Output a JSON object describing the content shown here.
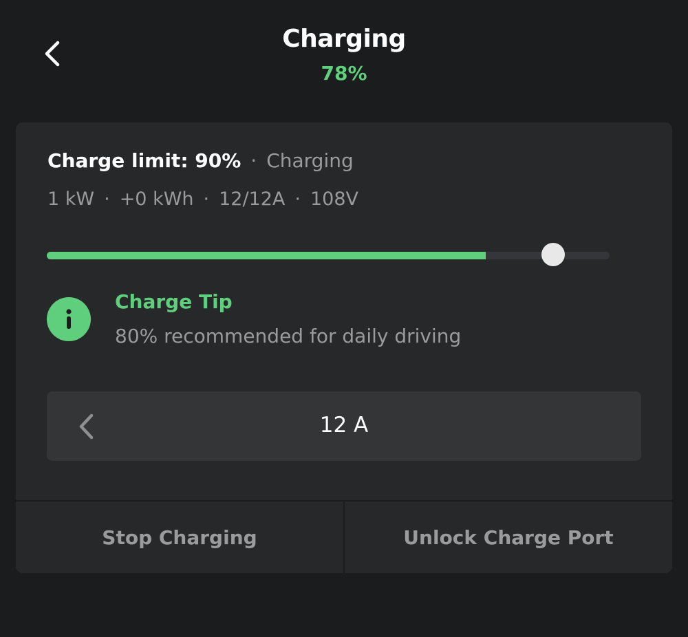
{
  "header": {
    "title": "Charging",
    "battery_percent": "78%"
  },
  "status": {
    "charge_limit": "Charge limit: 90%",
    "separator": "·",
    "state": "Charging"
  },
  "stats": {
    "power": "1 kW",
    "energy_added": "+0 kWh",
    "current": "12/12A",
    "voltage": "108V",
    "separator": "·"
  },
  "charge_level_slider": {
    "current_level": 0.78,
    "limit_level": 0.9
  },
  "tip": {
    "title": "Charge Tip",
    "body": "80% recommended for daily driving",
    "icon": "info-icon"
  },
  "amperage": {
    "value": "12 A"
  },
  "actions": {
    "stop": "Stop Charging",
    "unlock": "Unlock Charge Port"
  },
  "colors": {
    "background": "#1b1c1e",
    "card": "#27282a",
    "accent_green": "#5fcf7d",
    "muted_text": "#9a9b9d",
    "control_bg": "#343537"
  }
}
